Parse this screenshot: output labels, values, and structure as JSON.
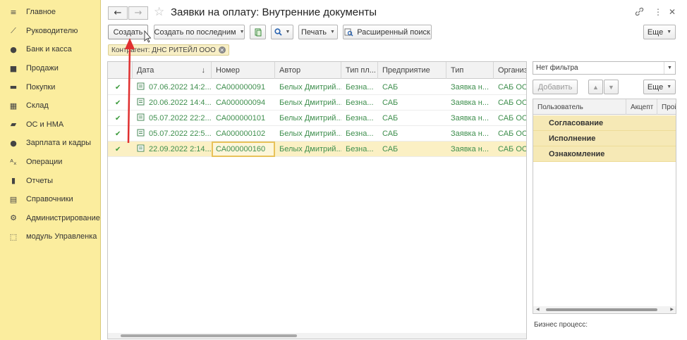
{
  "sidebar": {
    "items": [
      {
        "icon": "menu-icon",
        "glyph": "≡",
        "label": "Главное"
      },
      {
        "icon": "chart-trend-icon",
        "glyph": "⟋",
        "label": "Руководителю"
      },
      {
        "icon": "ruble-coin-icon",
        "glyph": "●",
        "label": "Банк и касса"
      },
      {
        "icon": "bag-icon",
        "glyph": "■",
        "label": "Продажи"
      },
      {
        "icon": "cart-icon",
        "glyph": "▬",
        "label": "Покупки"
      },
      {
        "icon": "warehouse-icon",
        "glyph": "▦",
        "label": "Склад"
      },
      {
        "icon": "truck-icon",
        "glyph": "▰",
        "label": "ОС и НМА"
      },
      {
        "icon": "person-icon",
        "glyph": "●",
        "label": "Зарплата и кадры"
      },
      {
        "icon": "operations-icon",
        "glyph": "ᴬₓ",
        "label": "Операции"
      },
      {
        "icon": "bar-chart-icon",
        "glyph": "▮",
        "label": "Отчеты"
      },
      {
        "icon": "books-icon",
        "glyph": "▤",
        "label": "Справочники"
      },
      {
        "icon": "gear-icon",
        "glyph": "⚙",
        "label": "Администрирование"
      },
      {
        "icon": "module-icon",
        "glyph": "⬚",
        "label": "модуль Управленка"
      }
    ]
  },
  "header": {
    "title": "Заявки на оплату: Внутренние документы",
    "back_glyph": "←",
    "forward_glyph": "→",
    "star_glyph": "☆",
    "link_glyph": "🔗",
    "more_glyph": "⋮",
    "close_glyph": "✕"
  },
  "toolbar": {
    "create": "Создать",
    "create_by_last": "Создать по последним",
    "search_glyph": "🔍",
    "print": "Печать",
    "advanced_search": "Расширенный поиск",
    "more": "Еще"
  },
  "filter": {
    "label": "Контрагент: ДНС РИТЕЙЛ ООО"
  },
  "table": {
    "columns": [
      "Дата",
      "Номер",
      "Автор",
      "Тип пл...",
      "Предприятие",
      "Тип",
      "Организа"
    ],
    "sort_glyph": "↓",
    "rows": [
      {
        "date": "07.06.2022 14:2...",
        "number": "СА000000091",
        "author": "Белых Дмитрий...",
        "pay_type": "Безна...",
        "company": "САБ",
        "type": "Заявка н...",
        "org": "САБ ООО"
      },
      {
        "date": "20.06.2022 14:4...",
        "number": "СА000000094",
        "author": "Белых Дмитрий...",
        "pay_type": "Безна...",
        "company": "САБ",
        "type": "Заявка н...",
        "org": "САБ ООО"
      },
      {
        "date": "05.07.2022 22:2...",
        "number": "СА000000101",
        "author": "Белых Дмитрий...",
        "pay_type": "Безна...",
        "company": "САБ",
        "type": "Заявка н...",
        "org": "САБ ООО"
      },
      {
        "date": "05.07.2022 22:5...",
        "number": "СА000000102",
        "author": "Белых Дмитрий...",
        "pay_type": "Безна...",
        "company": "САБ",
        "type": "Заявка н...",
        "org": "САБ ООО"
      },
      {
        "date": "22.09.2022 2:14...",
        "number": "СА000000160",
        "author": "Белых Дмитрий...",
        "pay_type": "Безна...",
        "company": "САБ",
        "type": "Заявка н...",
        "org": "САБ ООО"
      }
    ]
  },
  "right_panel": {
    "filter_select": "Нет фильтра",
    "add": "Добавить",
    "more": "Еще",
    "columns": [
      "Пользователь",
      "Акцепт",
      "Прой"
    ],
    "rows": [
      "Согласование",
      "Исполнение",
      "Ознакомление"
    ],
    "business_process_label": "Бизнес процесс:"
  },
  "colors": {
    "sidebar_bg": "#fbed9e",
    "row_text": "#3f8f4e",
    "selected_row": "#fbf0c4",
    "annotation_arrow": "#e03030"
  }
}
